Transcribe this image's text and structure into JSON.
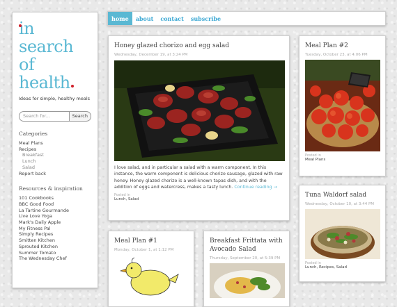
{
  "site": {
    "logo_lines": [
      "in",
      "search",
      "of",
      "health"
    ],
    "tagline": "Ideas for simple, healthy meals"
  },
  "search": {
    "placeholder": "Search for...",
    "button": "Search"
  },
  "categories": {
    "heading": "Categories",
    "items": [
      {
        "label": "Meal Plans",
        "sub": false
      },
      {
        "label": "Recipes",
        "sub": false
      },
      {
        "label": "Breakfast",
        "sub": true
      },
      {
        "label": "Lunch",
        "sub": true
      },
      {
        "label": "Salad",
        "sub": true
      },
      {
        "label": "Report back",
        "sub": false
      }
    ]
  },
  "resources": {
    "heading": "Resources & inspiration",
    "items": [
      "101 Cookbooks",
      "BBC Good Food",
      "La Tartine Gourmande",
      "Live Love Yoga",
      "Mark's Daily Apple",
      "My Fitness Pal",
      "Simply Recipes",
      "Smitten Kitchen",
      "Sprouted Kitchen",
      "Summer Tomato",
      "The Wednesday Chef"
    ]
  },
  "nav": [
    "home",
    "about",
    "contact",
    "subscribe"
  ],
  "posts": {
    "main": {
      "title": "Honey glazed chorizo and egg salad",
      "date": "Wednesday, December 19, at 3:24 PM",
      "body": "I love salad, and in particular a salad with a warm component. In this instance, the warm component is delicious chorizo sausage, glazed with raw honey. Honey glazed chorizo is a well-known tapas dish, and with the addition of eggs and watercress, makes a tasty lunch.",
      "more": "Continue reading →",
      "posted": "Posted in",
      "cats": "Lunch, Salad"
    },
    "mealplan2": {
      "title": "Meal Plan #2",
      "date": "Tuesday, October 23, at 4:06 PM",
      "posted": "Posted in",
      "cats": "Meal Plans"
    },
    "tuna": {
      "title": "Tuna Waldorf salad",
      "date": "Wednesday, October 10, at 3:44 PM",
      "posted": "Posted in",
      "cats": "Lunch, Recipes, Salad"
    },
    "mealplan1": {
      "title": "Meal Plan #1",
      "date": "Monday, October 1, at 1:12 PM"
    },
    "frittata": {
      "title": "Breakfast Frittata with Avocado Salad",
      "date": "Thursday, September 20, at 5:39 PM"
    }
  },
  "colors": {
    "accent": "#5ab8d3",
    "dot": "#d0202a"
  }
}
